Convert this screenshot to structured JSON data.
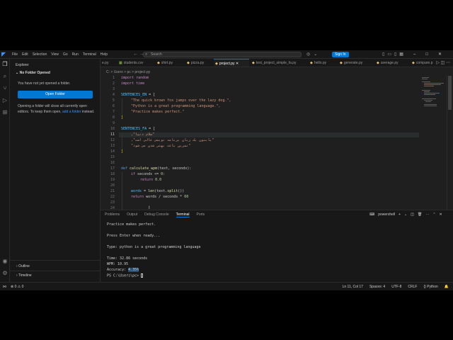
{
  "titlebar": {
    "menus": [
      "File",
      "Edit",
      "Selection",
      "View",
      "Go",
      "Run",
      "Terminal",
      "Help"
    ],
    "search_placeholder": "Search",
    "signin_label": "Sign In"
  },
  "sidebar": {
    "title": "Explorer",
    "no_folder": "No Folder Opened",
    "msg1": "You have not yet opened a folder.",
    "open_button": "Open Folder",
    "msg2_a": "Opening a folder will close all currently open editors. To keep them open, ",
    "msg2_link": "add a folder",
    "msg2_b": " instead.",
    "outline": "Outline",
    "timeline": "Timeline"
  },
  "tabs": [
    {
      "label": "e.py",
      "icon": "python-icon"
    },
    {
      "label": "students.csv",
      "icon": "csv-icon"
    },
    {
      "label": "shirt.py",
      "icon": "python-icon"
    },
    {
      "label": "pizza.py",
      "icon": "python-icon"
    },
    {
      "label": "project.py",
      "icon": "python-icon",
      "active": true
    },
    {
      "label": "test_project_simple_fa.py",
      "icon": "python-icon"
    },
    {
      "label": "hello.py",
      "icon": "python-icon"
    },
    {
      "label": "generate.py",
      "icon": "python-icon"
    },
    {
      "label": "average.py",
      "icon": "python-icon"
    },
    {
      "label": "compare.p",
      "icon": "python-icon"
    }
  ],
  "breadcrumb": "C: > Users > pc > project.py",
  "editor": {
    "line_numbers": [
      "1",
      "2",
      "3",
      "4",
      "5",
      "6",
      "7",
      "8",
      "9",
      "10",
      "11",
      "12",
      "13",
      "14",
      "15",
      "16",
      "17",
      "18",
      "19",
      "20",
      "21",
      "22",
      "23",
      "24"
    ],
    "lines": {
      "l1": "import random",
      "l2": "import time",
      "l4a": "SENTENCES_EN",
      "l4b": " = [",
      "l5": "\"The quick brown fox jumps over the lazy dog.\",",
      "l6": "\"Python is a great programming language.\",",
      "l7": "\"Practice makes perfect.\"",
      "l8": "]",
      "l10a": "SENTENCES_FA",
      "l10b": " = [",
      "l11": "\"سلام دنیا\",",
      "l12": "\"پایتون یک زبان برنامه نویسی عالی است\",",
      "l13": "\"تمرین باعث بهتر شدن می شود\"",
      "l14": "]",
      "l17a": "def",
      "l17b": "calculate_wpm",
      "l17c": "(text, seconds):",
      "l18a": "if",
      "l18b": " seconds <= ",
      "l18c": "0",
      "l18d": ":",
      "l19a": "return",
      "l19b": "0.0",
      "l21a": "words",
      "l21b": " = ",
      "l21c": "len",
      "l21d": "(text.",
      "l21e": "split",
      "l21f": "())",
      "l22a": "return",
      "l22b": " words / seconds * ",
      "l22c": "60"
    }
  },
  "panel": {
    "tabs": [
      "Problems",
      "Output",
      "Debug Console",
      "Terminal",
      "Ports"
    ],
    "active_tab": "Terminal",
    "shell": "powershell",
    "terminal": {
      "t1": "Practice makes perfect.",
      "t2": "Press Enter when ready...",
      "t3": "Type: python is a great programming language",
      "t4": "Time: 32.86 seconds",
      "t5": "WPM: 10.95",
      "t6a": "Accuracy: ",
      "t6b": "4.35%",
      "t7": "PS C:\\Users\\pc> "
    }
  },
  "status": {
    "errors": "0",
    "warnings": "0",
    "position": "Ln 11, Col 17",
    "spaces": "Spaces: 4",
    "encoding": "UTF-8",
    "eol": "CRLF",
    "language": "Python"
  },
  "colors": {
    "accent": "#0078d4",
    "background": "#1f1f1f",
    "sidebar": "#181818"
  }
}
